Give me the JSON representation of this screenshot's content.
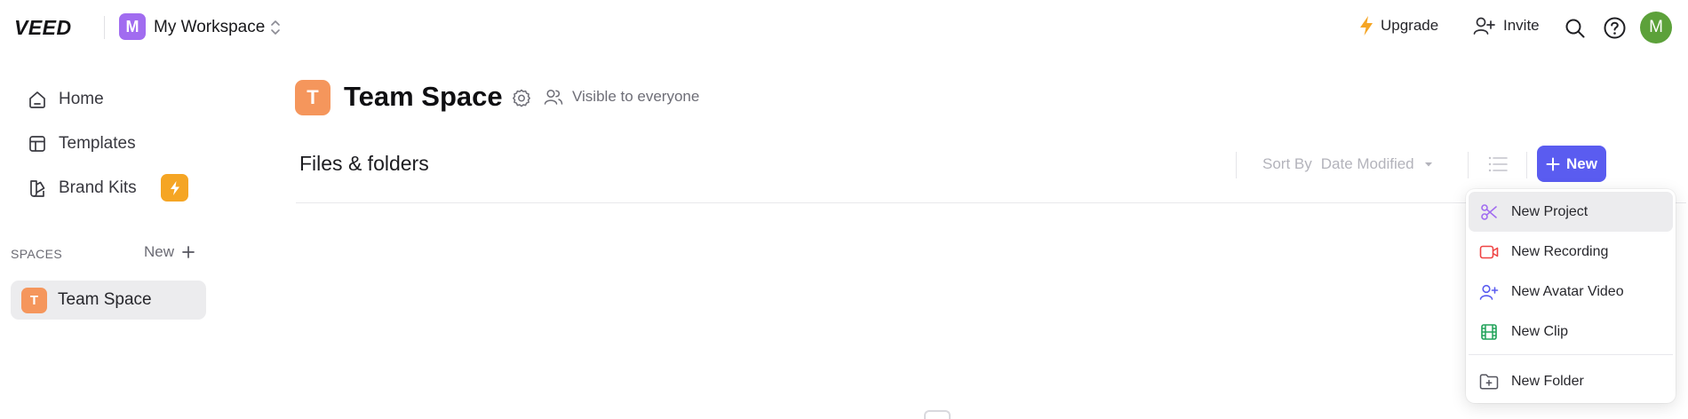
{
  "app": {
    "logo": "VEED"
  },
  "workspace": {
    "avatar_letter": "M",
    "name": "My Workspace",
    "avatar_color": "#a16cf0"
  },
  "topbar": {
    "upgrade_label": "Upgrade",
    "invite_label": "Invite",
    "user_initial": "M",
    "user_color": "#5ca13a"
  },
  "sidebar": {
    "items": [
      {
        "label": "Home",
        "icon": "home-icon"
      },
      {
        "label": "Templates",
        "icon": "templates-icon"
      },
      {
        "label": "Brand Kits",
        "icon": "brand-kits-icon"
      }
    ],
    "spaces_title": "SPACES",
    "spaces_new_label": "New",
    "spaces": [
      {
        "letter": "T",
        "label": "Team Space",
        "color": "#f5965c"
      }
    ]
  },
  "header": {
    "tile_letter": "T",
    "title": "Team Space",
    "visibility": "Visible to everyone"
  },
  "toolbar": {
    "section_title": "Files & folders",
    "sort_by_label": "Sort By",
    "sort_value": "Date Modified",
    "new_label": "New",
    "accent": "#5a5cf0"
  },
  "new_menu": {
    "items": [
      {
        "label": "New Project",
        "icon": "scissors-icon",
        "color": "#a16cf0"
      },
      {
        "label": "New Recording",
        "icon": "video-camera-icon",
        "color": "#ef4444"
      },
      {
        "label": "New Avatar Video",
        "icon": "user-plus-icon",
        "color": "#5a5cf0"
      },
      {
        "label": "New Clip",
        "icon": "film-icon",
        "color": "#22a35a"
      },
      {
        "label": "New Folder",
        "icon": "folder-plus-icon",
        "color": "#55555e"
      }
    ]
  }
}
